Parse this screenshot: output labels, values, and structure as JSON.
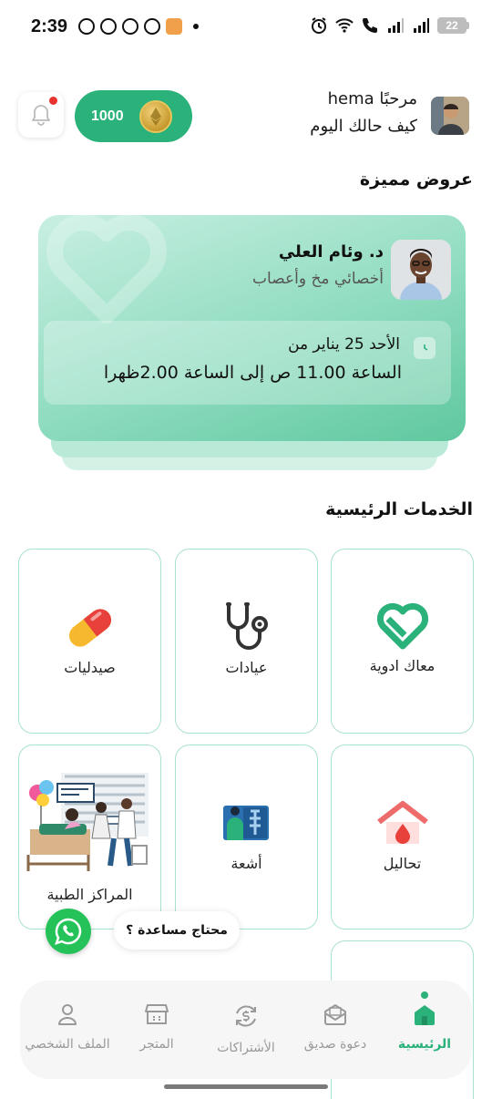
{
  "status_bar": {
    "time": "2:39",
    "battery": "22",
    "app_icons": [
      "whatsapp-icon",
      "snapchat-icon",
      "messenger-icon",
      "tiktok-icon",
      "shop-icon"
    ],
    "right_icons": [
      "alarm-icon",
      "wifi-icon",
      "call-icon",
      "signal-icon",
      "signal-icon"
    ]
  },
  "header": {
    "greeting": "مرحبًا hema",
    "subtitle": "كيف حالك اليوم",
    "coins": "1000"
  },
  "featured": {
    "title": "عروض مميزة",
    "doctor_name": "د. وئام العلي",
    "specialty": "أخصائي مخ وأعصاب",
    "date_line": "الأحد 25 يناير من",
    "time_line": "الساعة 11.00 ص إلى الساعة 2.00ظهرا"
  },
  "services": {
    "title": "الخدمات الرئيسية",
    "items": [
      {
        "label": "معاك ادوية",
        "icon": "heart-medicine-icon"
      },
      {
        "label": "عيادات",
        "icon": "stethoscope-icon"
      },
      {
        "label": "صيدليات",
        "icon": "pill-capsule-icon"
      },
      {
        "label": "تحاليل",
        "icon": "lab-house-drop-icon"
      },
      {
        "label": "أشعة",
        "icon": "xray-icon"
      },
      {
        "label": "المراكز الطبية",
        "icon": "medical-center-illustration"
      }
    ]
  },
  "help": {
    "label": "محتاج مساعدة ؟"
  },
  "bottom_nav": {
    "items": [
      {
        "label": "الرئيسية",
        "icon": "home-icon",
        "active": true
      },
      {
        "label": "دعوة صديق",
        "icon": "invite-icon",
        "active": false
      },
      {
        "label": "الأشتراكات",
        "icon": "subscription-icon",
        "active": false
      },
      {
        "label": "المتجر",
        "icon": "store-icon",
        "active": false
      },
      {
        "label": "الملف الشخصي",
        "icon": "profile-icon",
        "active": false
      }
    ]
  },
  "colors": {
    "brand": "#2bb17a",
    "card_light": "#c9efe2",
    "card_dark": "#5fc89f",
    "service_border": "#a9e2cb",
    "notification_dot": "#e8322e"
  }
}
